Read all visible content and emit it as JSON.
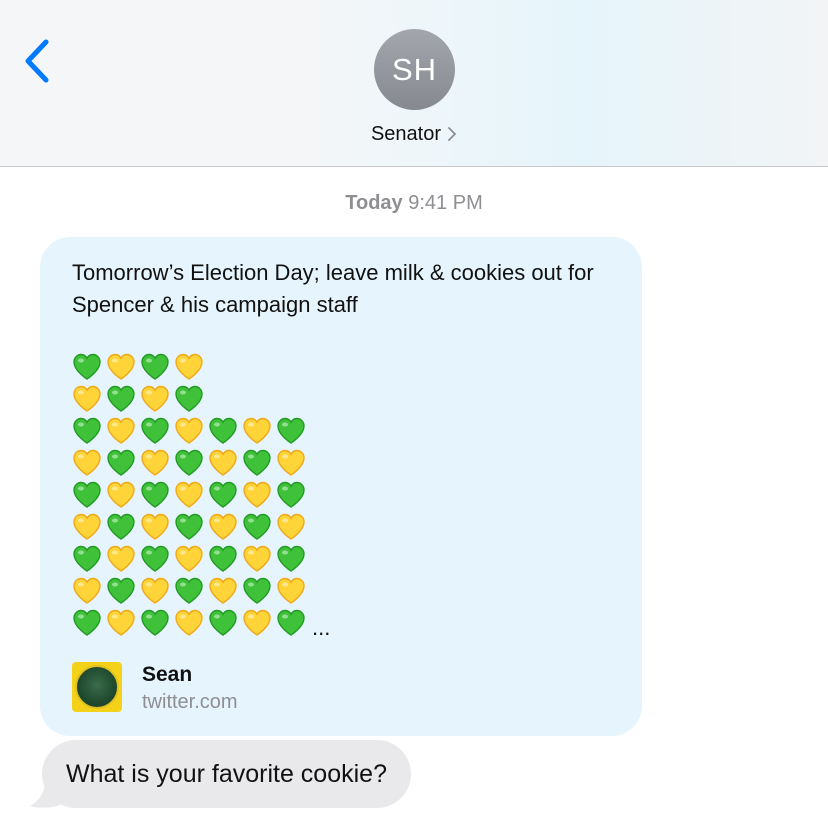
{
  "header": {
    "back_icon": "chevron-left-icon",
    "avatar_initials": "SH",
    "contact_name": "Senator",
    "disclosure_icon": "chevron-right-icon",
    "accent_color": "#007aff"
  },
  "conversation": {
    "timestamp_day": "Today",
    "timestamp_time": "9:41 PM",
    "link_message": {
      "text": "Tomorrow’s Election Day; leave milk & cookies out for Spencer & his campaign staff",
      "emoji_rows": [
        [
          "green",
          "yellow",
          "green",
          "yellow"
        ],
        [
          "yellow",
          "green",
          "yellow",
          "green"
        ],
        [
          "green",
          "yellow",
          "green",
          "yellow",
          "green",
          "yellow",
          "green"
        ],
        [
          "yellow",
          "green",
          "yellow",
          "green",
          "yellow",
          "green",
          "yellow"
        ],
        [
          "green",
          "yellow",
          "green",
          "yellow",
          "green",
          "yellow",
          "green"
        ],
        [
          "yellow",
          "green",
          "yellow",
          "green",
          "yellow",
          "green",
          "yellow"
        ],
        [
          "green",
          "yellow",
          "green",
          "yellow",
          "green",
          "yellow",
          "green"
        ],
        [
          "yellow",
          "green",
          "yellow",
          "green",
          "yellow",
          "green",
          "yellow"
        ],
        [
          "green",
          "yellow",
          "green",
          "yellow",
          "green",
          "yellow",
          "green"
        ]
      ],
      "truncation": "...",
      "source_name": "Sean",
      "source_domain": "twitter.com",
      "bubble_color": "#e6f5fd"
    },
    "incoming_message": {
      "text": "What is your favorite cookie?",
      "bubble_color": "#e9e9eb"
    }
  }
}
